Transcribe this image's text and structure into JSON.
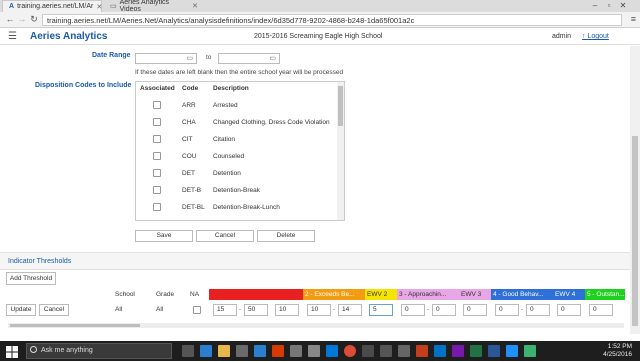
{
  "browser": {
    "tabs": [
      {
        "label": "training.aeries.net/LM/Ar",
        "favicon": "aeries-icon"
      },
      {
        "label": "Aeries Analytics Videos",
        "favicon": "page-icon"
      }
    ],
    "url": "training.aeries.net/LM/Aeries.Net/Analytics/analysisdefinitions/index/6d35d778-9202-4868-b248-1da65f001a2c"
  },
  "app": {
    "brand": "Aeries Analytics",
    "school": "2015-2016 Screaming Eagle High School",
    "user": "admin",
    "logout": "Logout",
    "logout_icon": "↑"
  },
  "form": {
    "date_range_label": "Date Range",
    "date_to": "to",
    "date_hint": "If these dates are left blank then the entire school year will be processed",
    "codes_label": "Disposition Codes to Include",
    "codes_headers": {
      "associated": "Associated",
      "code": "Code",
      "description": "Description"
    },
    "codes": [
      {
        "code": "ARR",
        "description": "Arrested"
      },
      {
        "code": "CHA",
        "description": "Changed Clothing, Dress Code Violation"
      },
      {
        "code": "CIT",
        "description": "Citation"
      },
      {
        "code": "COU",
        "description": "Counseled"
      },
      {
        "code": "DET",
        "description": "Detention"
      },
      {
        "code": "DET-B",
        "description": "Detention-Break"
      },
      {
        "code": "DET-BL",
        "description": "Detention-Break-Lunch"
      }
    ],
    "save": "Save",
    "cancel": "Cancel",
    "delete": "Delete"
  },
  "thresholds": {
    "section_title": "Indicator Thresholds",
    "add_button": "Add Threshold",
    "headers": {
      "school": "School",
      "grade": "Grade",
      "na": "NA",
      "bands": [
        {
          "label": "",
          "color": "#e8201f",
          "text_color": "#ffffff"
        },
        {
          "label": "",
          "color": "#e8201f",
          "text_color": "#ffffff"
        },
        {
          "label": "2 - Exceeds Be...",
          "color": "#f39c12",
          "text_color": "#ffffff"
        },
        {
          "label": "EWV 2",
          "color": "#f5e400",
          "text_color": "#333333"
        },
        {
          "label": "3 - Approachin...",
          "color": "#e9a6e6",
          "text_color": "#333333"
        },
        {
          "label": "EWV 3",
          "color": "#e9a6e6",
          "text_color": "#333333"
        },
        {
          "label": "4 - Good Behav...",
          "color": "#2e6fd8",
          "text_color": "#ffffff"
        },
        {
          "label": "EWV 4",
          "color": "#2e6fd8",
          "text_color": "#ffffff"
        },
        {
          "label": "5 - Outstan...",
          "color": "#1fd11f",
          "text_color": "#ffffff"
        }
      ]
    },
    "row": {
      "update": "Update",
      "cancel": "Cancel",
      "school": "All",
      "grade": "All",
      "values": [
        "15",
        "50",
        "10",
        "10",
        "14",
        "5",
        "0",
        "0",
        "0",
        "0",
        "0",
        "0",
        "0"
      ]
    }
  },
  "taskbar": {
    "search_placeholder": "Ask me anything",
    "time": "1:52 PM",
    "date": "4/25/2016"
  }
}
